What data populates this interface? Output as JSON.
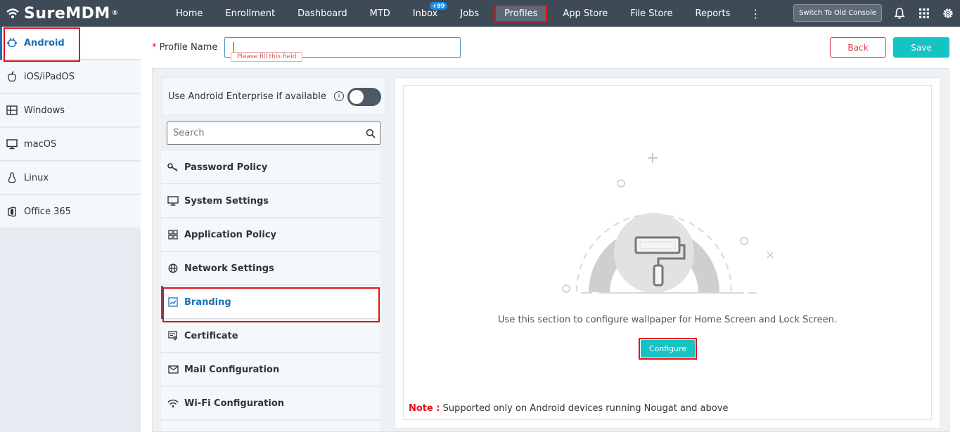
{
  "app": {
    "logo_text": "SureMDM",
    "logo_mark": "®"
  },
  "nav": {
    "items": [
      {
        "label": "Home"
      },
      {
        "label": "Enrollment"
      },
      {
        "label": "Dashboard"
      },
      {
        "label": "MTD"
      },
      {
        "label": "Inbox",
        "badge": "+99"
      },
      {
        "label": "Jobs"
      },
      {
        "label": "Profiles",
        "active": true
      },
      {
        "label": "App Store"
      },
      {
        "label": "File Store"
      },
      {
        "label": "Reports"
      }
    ],
    "more_icon": "⋮",
    "switch_console": "Switch To Old Console",
    "icons": [
      "bell-icon",
      "apps-grid-icon",
      "gear-icon"
    ]
  },
  "sidebar": {
    "items": [
      {
        "label": "Android",
        "icon": "android-icon",
        "active": true
      },
      {
        "label": "iOS/iPadOS",
        "icon": "apple-icon"
      },
      {
        "label": "Windows",
        "icon": "windows-icon"
      },
      {
        "label": "macOS",
        "icon": "monitor-icon"
      },
      {
        "label": "Linux",
        "icon": "linux-icon"
      },
      {
        "label": "Office 365",
        "icon": "office-icon"
      }
    ]
  },
  "profile": {
    "name_label": "Profile Name",
    "name_value": "",
    "validation_tooltip": "Please fill this field",
    "back_label": "Back",
    "save_label": "Save"
  },
  "policy_panel": {
    "android_enterprise_label": "Use Android Enterprise if available",
    "info_icon": "i",
    "toggle_on": false,
    "search_placeholder": "Search",
    "items": [
      {
        "label": "Password Policy",
        "icon": "key-icon"
      },
      {
        "label": "System Settings",
        "icon": "monitor-icon"
      },
      {
        "label": "Application Policy",
        "icon": "apps-icon"
      },
      {
        "label": "Network Settings",
        "icon": "globe-icon"
      },
      {
        "label": "Branding",
        "icon": "branding-icon",
        "active": true
      },
      {
        "label": "Certificate",
        "icon": "certificate-icon"
      },
      {
        "label": "Mail Configuration",
        "icon": "mail-icon"
      },
      {
        "label": "Wi-Fi Configuration",
        "icon": "wifi-icon"
      }
    ]
  },
  "branding": {
    "description": "Use this section to configure wallpaper for Home Screen and Lock Screen.",
    "configure_label": "Configure",
    "note_label": "Note :",
    "note_text": "Supported only on Android devices running Nougat and above"
  },
  "colors": {
    "topbar": "#3e4a56",
    "accent_teal": "#17c2c2",
    "link_blue": "#1a6fb5",
    "highlight_red": "#e0101a"
  }
}
